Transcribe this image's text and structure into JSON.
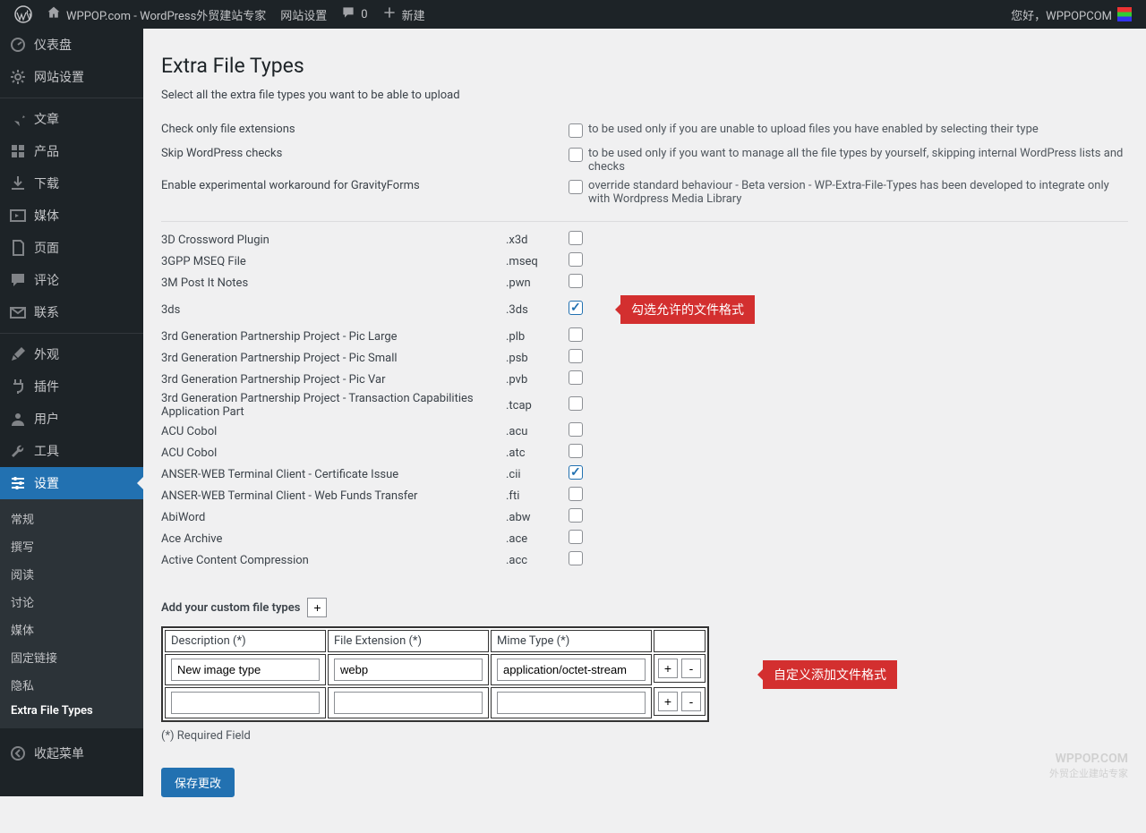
{
  "adminbar": {
    "site_name": "WPPOP.com - WordPress外贸建站专家",
    "site_settings": "网站设置",
    "comments_count": "0",
    "new": "新建",
    "greeting": "您好，WPPOPCOM"
  },
  "sidebar": {
    "items": [
      {
        "icon": "dashboard",
        "label": "仪表盘"
      },
      {
        "icon": "gear",
        "label": "网站设置"
      },
      {
        "sep": true
      },
      {
        "icon": "pin",
        "label": "文章"
      },
      {
        "icon": "grid",
        "label": "产品"
      },
      {
        "icon": "download",
        "label": "下载"
      },
      {
        "icon": "media",
        "label": "媒体"
      },
      {
        "icon": "page",
        "label": "页面"
      },
      {
        "icon": "comment",
        "label": "评论"
      },
      {
        "icon": "mail",
        "label": "联系"
      },
      {
        "sep": true
      },
      {
        "icon": "brush",
        "label": "外观"
      },
      {
        "icon": "plug",
        "label": "插件"
      },
      {
        "icon": "user",
        "label": "用户"
      },
      {
        "icon": "wrench",
        "label": "工具"
      },
      {
        "icon": "sliders",
        "label": "设置",
        "current": true
      }
    ],
    "submenu": [
      "常规",
      "撰写",
      "阅读",
      "讨论",
      "媒体",
      "固定链接",
      "隐私",
      "Extra File Types"
    ],
    "submenu_current": 7,
    "collapse": "收起菜单"
  },
  "page": {
    "title": "Extra File Types",
    "subtitle": "Select all the extra file types you want to be able to upload",
    "options": [
      {
        "label": "Check only file extensions",
        "desc": "to be used only if you are unable to upload files you have enabled by selecting their type"
      },
      {
        "label": "Skip WordPress checks",
        "desc": "to be used only if you want to manage all the file types by yourself, skipping internal WordPress lists and checks"
      },
      {
        "label": "Enable experimental workaround for GravityForms",
        "desc": "override standard behaviour - Beta version - WP-Extra-File-Types has been developed to integrate only with Wordpress Media Library"
      }
    ],
    "filetypes": [
      {
        "name": "3D Crossword Plugin",
        "ext": ".x3d",
        "checked": false
      },
      {
        "name": "3GPP MSEQ File",
        "ext": ".mseq",
        "checked": false
      },
      {
        "name": "3M Post It Notes",
        "ext": ".pwn",
        "checked": false
      },
      {
        "name": "3ds",
        "ext": ".3ds",
        "checked": true,
        "callout": "勾选允许的文件格式"
      },
      {
        "name": "3rd Generation Partnership Project - Pic Large",
        "ext": ".plb",
        "checked": false
      },
      {
        "name": "3rd Generation Partnership Project - Pic Small",
        "ext": ".psb",
        "checked": false
      },
      {
        "name": "3rd Generation Partnership Project - Pic Var",
        "ext": ".pvb",
        "checked": false
      },
      {
        "name": "3rd Generation Partnership Project - Transaction Capabilities Application Part",
        "ext": ".tcap",
        "checked": false
      },
      {
        "name": "ACU Cobol",
        "ext": ".acu",
        "checked": false
      },
      {
        "name": "ACU Cobol",
        "ext": ".atc",
        "checked": false
      },
      {
        "name": "ANSER-WEB Terminal Client - Certificate Issue",
        "ext": ".cii",
        "checked": true
      },
      {
        "name": "ANSER-WEB Terminal Client - Web Funds Transfer",
        "ext": ".fti",
        "checked": false
      },
      {
        "name": "AbiWord",
        "ext": ".abw",
        "checked": false
      },
      {
        "name": "Ace Archive",
        "ext": ".ace",
        "checked": false
      },
      {
        "name": "Active Content Compression",
        "ext": ".acc",
        "checked": false
      }
    ],
    "custom_heading": "Add your custom file types",
    "custom_table": {
      "headers": [
        "Description (*)",
        "File Extension (*)",
        "Mime Type (*)"
      ],
      "rows": [
        {
          "desc": "New image type",
          "ext": "webp",
          "mime": "application/octet-stream"
        },
        {
          "desc": "",
          "ext": "",
          "mime": ""
        }
      ]
    },
    "custom_callout": "自定义添加文件格式",
    "required_note": "(*) Required Field",
    "save": "保存更改"
  },
  "watermark": {
    "line1": "WPPOP.COM",
    "line2": "外贸企业建站专家"
  }
}
